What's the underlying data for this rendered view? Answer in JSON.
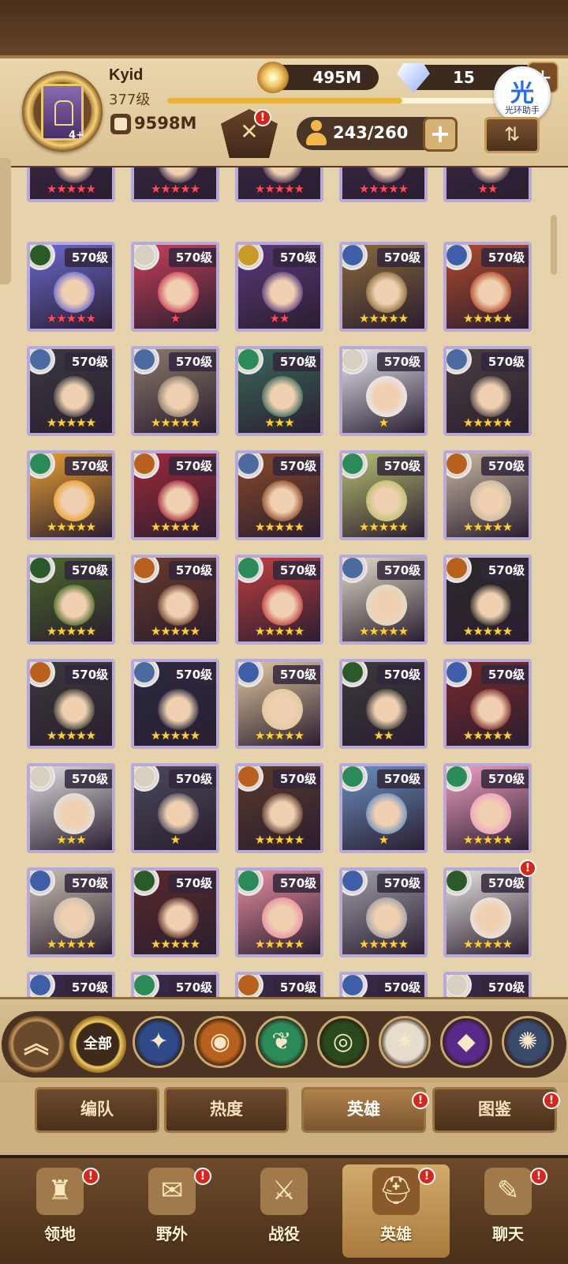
{
  "player": {
    "name": "Kyid",
    "level": "377级",
    "power": "9598M",
    "xp_progress": 0.71,
    "avatar_badge": "4+"
  },
  "resources": {
    "gold": "495M",
    "gems": "15",
    "gem_plus": "+"
  },
  "assistant": {
    "char": "光",
    "label": "光环助手"
  },
  "hero_capacity": {
    "count": "243/260",
    "plus": "+"
  },
  "sort_button": "⇅",
  "alert_mark": "!",
  "hero_rows": [
    {
      "partial_top": true,
      "heroes": [
        {
          "stars": 5,
          "star_color": "red"
        },
        {
          "stars": 5,
          "star_color": "red"
        },
        {
          "stars": 5,
          "star_color": "red"
        },
        {
          "stars": 5,
          "star_color": "red"
        },
        {
          "stars": 2,
          "star_color": "red"
        }
      ]
    },
    {
      "heroes": [
        {
          "level": "570级",
          "stars": 5,
          "star_color": "red",
          "faction": "forest",
          "tint": "#6a6ad0"
        },
        {
          "level": "570级",
          "stars": 1,
          "star_color": "red",
          "faction": "celestial",
          "tint": "#c8405a"
        },
        {
          "level": "570级",
          "stars": 2,
          "star_color": "red",
          "faction": "graveborn",
          "tint": "#5a3a7a"
        },
        {
          "level": "570级",
          "stars": 5,
          "star_color": "gold",
          "faction": "lightbearer",
          "tint": "#8a6a3a"
        },
        {
          "level": "570级",
          "stars": 5,
          "star_color": "gold",
          "faction": "lightbearer",
          "tint": "#b04a2a"
        }
      ]
    },
    {
      "heroes": [
        {
          "level": "570级",
          "stars": 5,
          "star_color": "gold",
          "faction": "dimensional",
          "tint": "#3a3a40"
        },
        {
          "level": "570级",
          "stars": 5,
          "star_color": "gold",
          "faction": "dimensional",
          "tint": "#8a7a6a"
        },
        {
          "level": "570级",
          "stars": 3,
          "star_color": "gold",
          "faction": "wilder",
          "tint": "#3a6a5a"
        },
        {
          "level": "570级",
          "stars": 1,
          "star_color": "gold",
          "faction": "celestial",
          "tint": "#e8e8f0"
        },
        {
          "level": "570级",
          "stars": 5,
          "star_color": "gold",
          "faction": "dimensional",
          "tint": "#4a4040"
        }
      ]
    },
    {
      "heroes": [
        {
          "level": "570级",
          "stars": 5,
          "star_color": "gold",
          "faction": "wilder",
          "tint": "#e8a030"
        },
        {
          "level": "570级",
          "stars": 5,
          "star_color": "gold",
          "faction": "mauler",
          "tint": "#a02a3a"
        },
        {
          "level": "570级",
          "stars": 5,
          "star_color": "gold",
          "faction": "dimensional",
          "tint": "#8a4a2a"
        },
        {
          "level": "570级",
          "stars": 5,
          "star_color": "gold",
          "faction": "wilder",
          "tint": "#b8c070"
        },
        {
          "level": "570级",
          "stars": 5,
          "star_color": "gold",
          "faction": "mauler",
          "tint": "#c8b8a0"
        }
      ]
    },
    {
      "heroes": [
        {
          "level": "570级",
          "stars": 5,
          "star_color": "gold",
          "faction": "forest",
          "tint": "#4a6a2a"
        },
        {
          "level": "570级",
          "stars": 5,
          "star_color": "gold",
          "faction": "mauler",
          "tint": "#6a3a2a"
        },
        {
          "level": "570级",
          "stars": 5,
          "star_color": "gold",
          "faction": "wilder",
          "tint": "#c04040"
        },
        {
          "level": "570级",
          "stars": 5,
          "star_color": "gold",
          "faction": "dimensional",
          "tint": "#e0dcc8"
        },
        {
          "level": "570级",
          "stars": 5,
          "star_color": "gold",
          "faction": "mauler",
          "tint": "#2a2a2a"
        }
      ]
    },
    {
      "heroes": [
        {
          "level": "570级",
          "stars": 5,
          "star_color": "gold",
          "faction": "mauler",
          "tint": "#3a3a3a"
        },
        {
          "level": "570级",
          "stars": 5,
          "star_color": "gold",
          "faction": "dimensional",
          "tint": "#2a2a40"
        },
        {
          "level": "570级",
          "stars": 5,
          "star_color": "gold",
          "faction": "lightbearer",
          "tint": "#e0c8a0"
        },
        {
          "level": "570级",
          "stars": 2,
          "star_color": "gold",
          "faction": "forest",
          "tint": "#3a3a3a"
        },
        {
          "level": "570级",
          "stars": 5,
          "star_color": "gold",
          "faction": "lightbearer",
          "tint": "#7a2a2a"
        }
      ]
    },
    {
      "heroes": [
        {
          "level": "570级",
          "stars": 3,
          "star_color": "gold",
          "faction": "celestial",
          "tint": "#e0e0e0"
        },
        {
          "level": "570级",
          "stars": 1,
          "star_color": "gold",
          "faction": "celestial",
          "tint": "#4a4a5a"
        },
        {
          "level": "570级",
          "stars": 5,
          "star_color": "gold",
          "faction": "mauler",
          "tint": "#5a3a2a"
        },
        {
          "level": "570级",
          "stars": 1,
          "star_color": "gold",
          "faction": "wilder",
          "tint": "#6a90c0"
        },
        {
          "level": "570级",
          "stars": 5,
          "star_color": "gold",
          "faction": "wilder",
          "tint": "#f0a0c0"
        }
      ]
    },
    {
      "heroes": [
        {
          "level": "570级",
          "stars": 5,
          "star_color": "gold",
          "faction": "lightbearer",
          "tint": "#c8c0b0"
        },
        {
          "level": "570级",
          "stars": 5,
          "star_color": "gold",
          "faction": "forest",
          "tint": "#5a2a2a"
        },
        {
          "level": "570级",
          "stars": 5,
          "star_color": "gold",
          "faction": "wilder",
          "tint": "#e890a0"
        },
        {
          "level": "570级",
          "stars": 5,
          "star_color": "gold",
          "faction": "lightbearer",
          "tint": "#a0a0a8"
        },
        {
          "level": "570级",
          "stars": 5,
          "star_color": "gold",
          "faction": "forest",
          "tint": "#e8e4e0",
          "alert": true
        }
      ]
    },
    {
      "partial_bottom": true,
      "heroes": [
        {
          "level": "570级",
          "faction": "lightbearer"
        },
        {
          "level": "570级",
          "faction": "wilder"
        },
        {
          "level": "570级",
          "faction": "mauler"
        },
        {
          "level": "570级",
          "faction": "lightbearer"
        },
        {
          "level": "570级",
          "faction": "celestial"
        }
      ]
    }
  ],
  "faction_colors": {
    "lightbearer": "#3e5fa8",
    "mauler": "#b8601e",
    "wilder": "#2a8a5a",
    "graveborn": "#c89a2a",
    "celestial": "#d8d0c0",
    "hypogean": "#6a3aa8",
    "dimensional": "#4a6aa0",
    "forest": "#2a5a2a"
  },
  "faction_filter": {
    "up_label": "︽",
    "all_label": "全部",
    "chips": [
      {
        "icon": "lightbearer-star-icon",
        "color": "#2f4a88",
        "glyph": "✦"
      },
      {
        "icon": "mauler-icon",
        "color": "#b8601e",
        "glyph": "◉"
      },
      {
        "icon": "wilder-leaf-icon",
        "color": "#2a8a5a",
        "glyph": "❦"
      },
      {
        "icon": "graveborn-eye-icon",
        "color": "#2a4a1e",
        "glyph": "◎"
      },
      {
        "icon": "celestial-icon",
        "color": "#e6dccb",
        "glyph": "✷"
      },
      {
        "icon": "hypogean-icon",
        "color": "#5a2a8a",
        "glyph": "◆"
      },
      {
        "icon": "dimensional-icon",
        "color": "#3a4a6a",
        "glyph": "✺"
      }
    ]
  },
  "subtabs": [
    {
      "label": "编队",
      "active": false,
      "alert": false
    },
    {
      "label": "热度",
      "active": false,
      "alert": false
    },
    {
      "label": "英雄",
      "active": true,
      "alert": true
    },
    {
      "label": "图鉴",
      "active": false,
      "alert": true
    }
  ],
  "bottom_nav": [
    {
      "label": "领地",
      "icon": "castle-icon",
      "glyph": "♜",
      "active": false,
      "alert": true
    },
    {
      "label": "野外",
      "icon": "map-scroll-icon",
      "glyph": "✉",
      "active": false,
      "alert": true
    },
    {
      "label": "战役",
      "icon": "campaign-icon",
      "glyph": "⚔",
      "active": false,
      "alert": false
    },
    {
      "label": "英雄",
      "icon": "hero-helmet-icon",
      "glyph": "⛑",
      "active": true,
      "alert": true
    },
    {
      "label": "聊天",
      "icon": "chat-icon",
      "glyph": "✎",
      "active": false,
      "alert": true
    }
  ]
}
